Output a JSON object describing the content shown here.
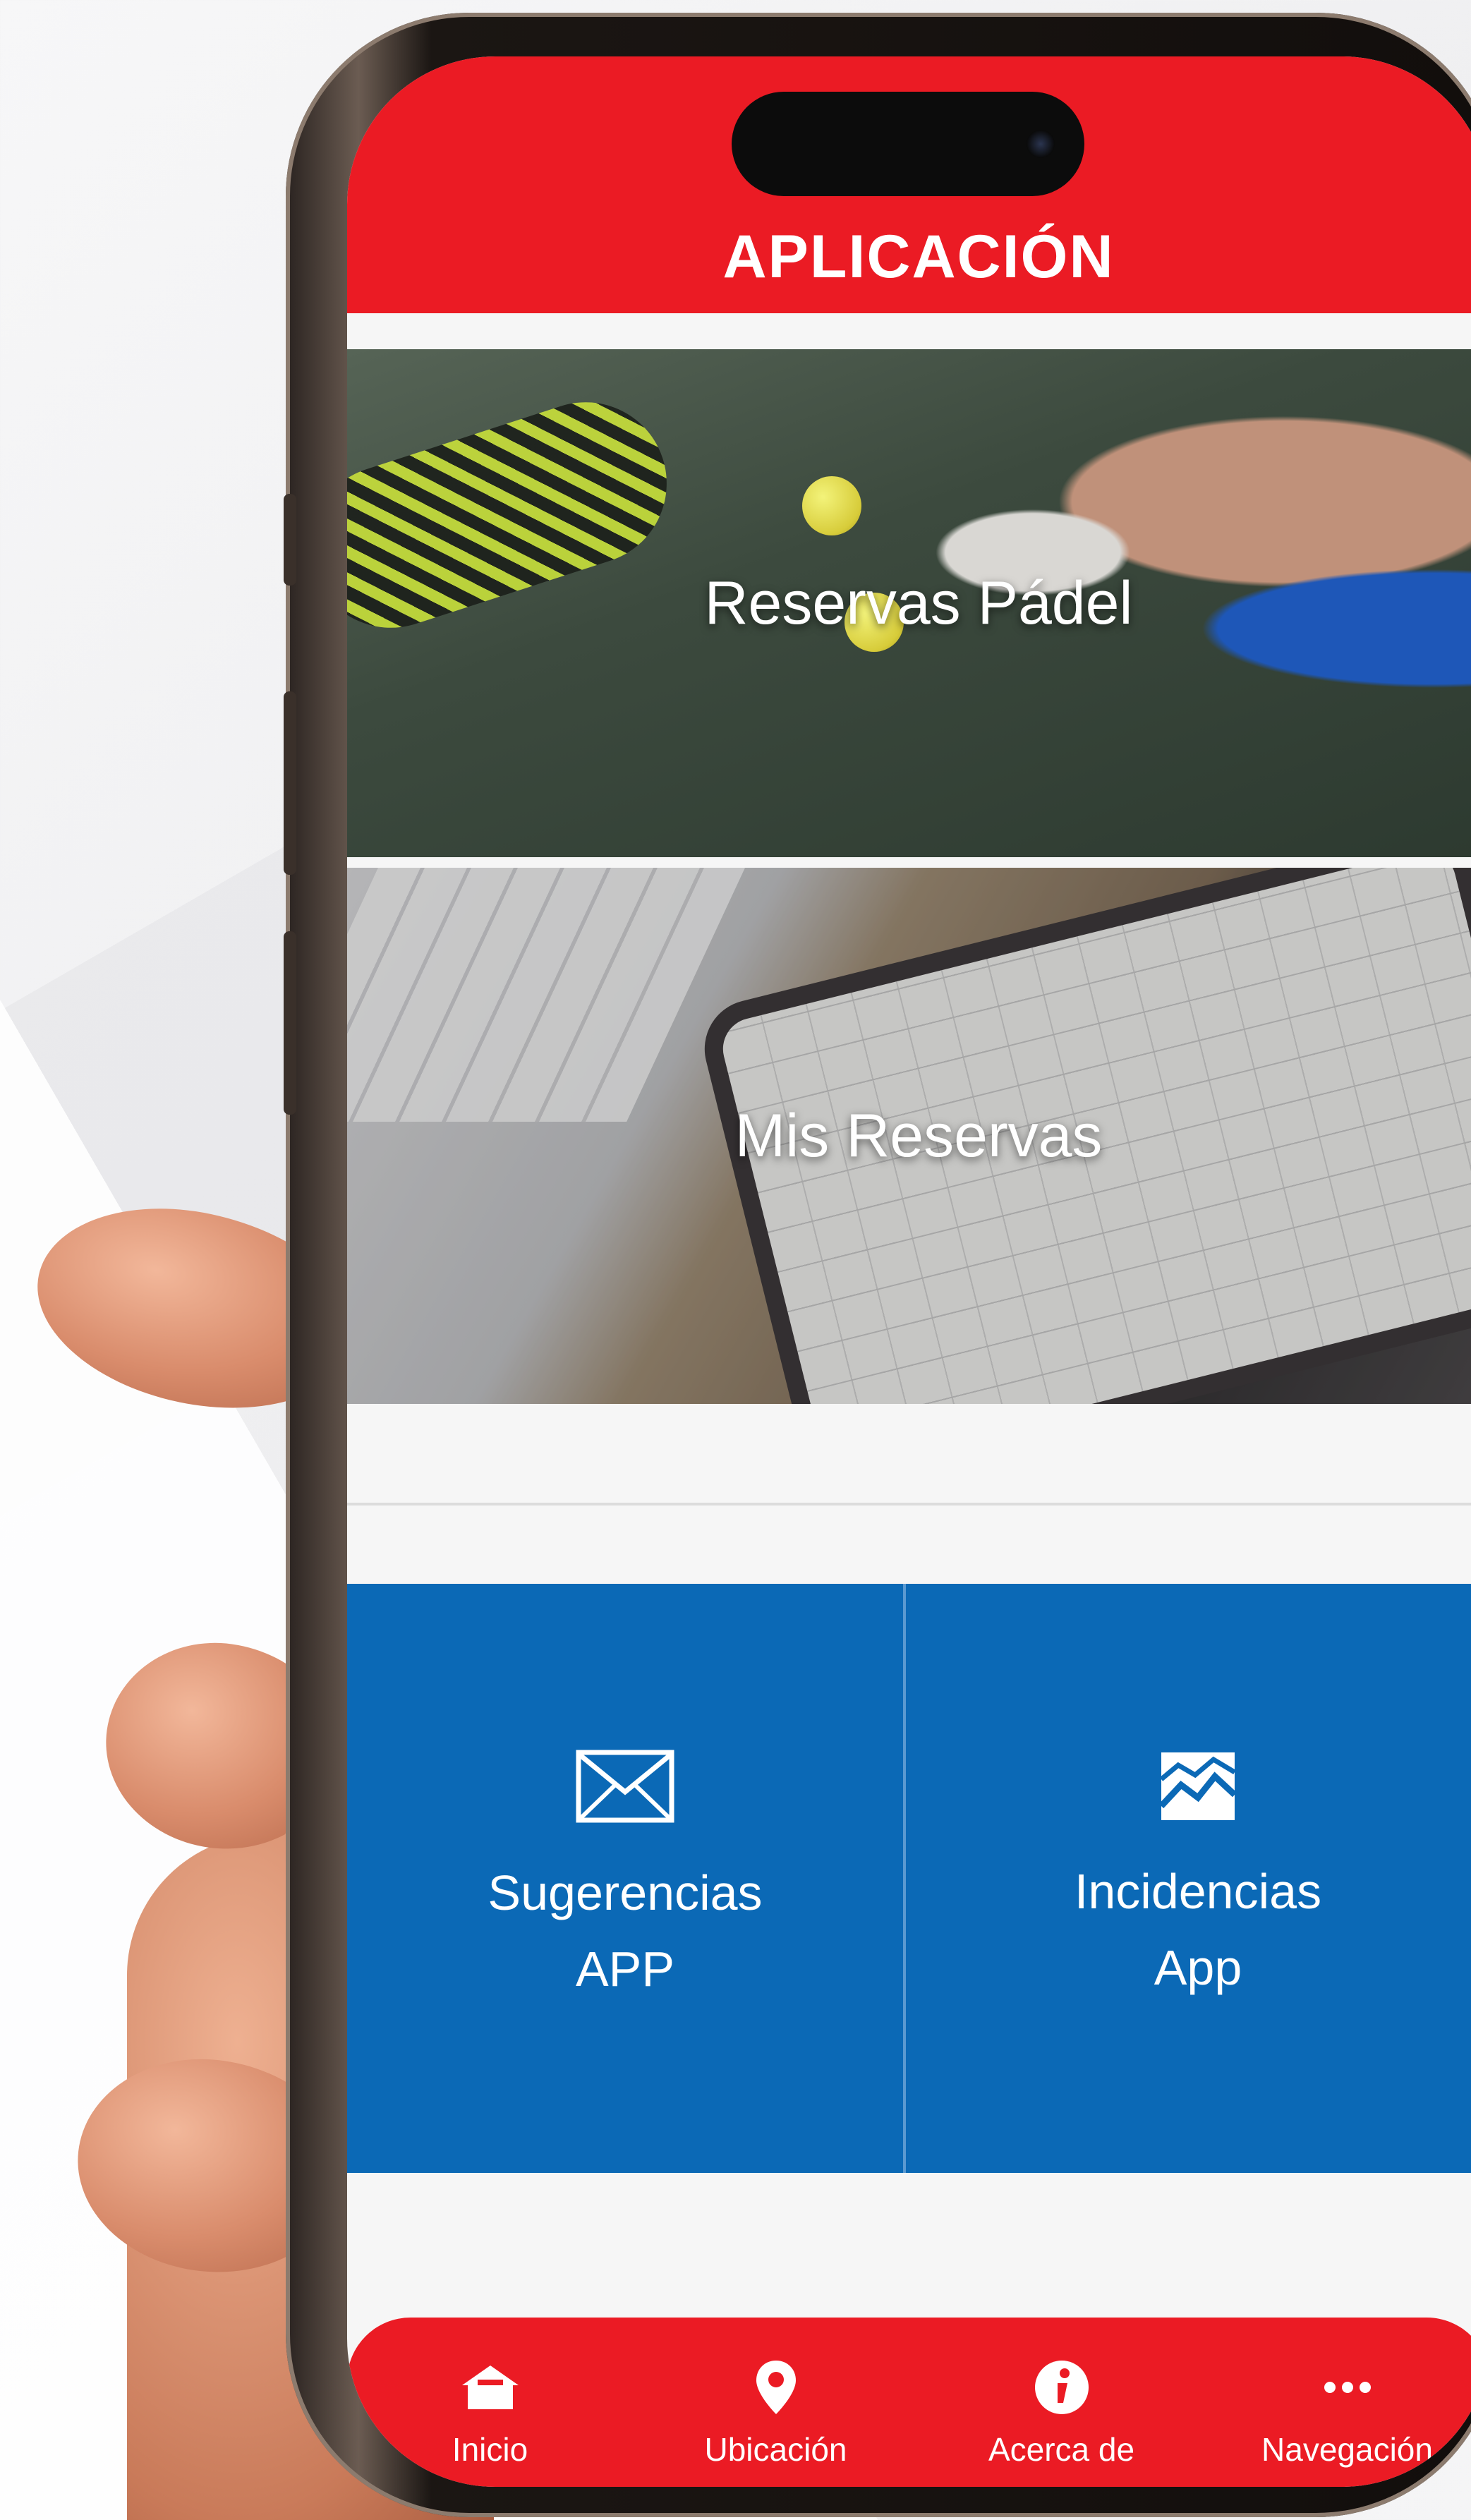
{
  "app": {
    "title": "APLICACIÓN"
  },
  "cards": [
    {
      "label": "Reservas Pádel"
    },
    {
      "label": "Mis Reservas"
    }
  ],
  "tiles": [
    {
      "label": "Sugerencias\nAPP",
      "icon": "envelope-icon"
    },
    {
      "label": "Incidencias\nApp",
      "icon": "image-icon"
    }
  ],
  "bottom_nav": {
    "items": [
      {
        "label": "Inicio",
        "icon": "home-icon"
      },
      {
        "label": "Ubicación",
        "icon": "location-pin-icon"
      },
      {
        "label": "Acerca de",
        "icon": "info-icon"
      },
      {
        "label": "Navegación",
        "icon": "more-dots-icon"
      }
    ]
  },
  "colors": {
    "header_red": "#eb1b24",
    "tile_blue": "#0b69b6",
    "text_white": "#ffffff"
  }
}
